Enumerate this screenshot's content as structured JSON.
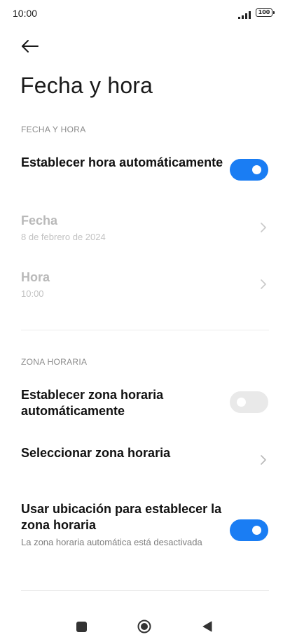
{
  "status_bar": {
    "time": "10:00",
    "battery": "100"
  },
  "header": {
    "title": "Fecha y hora"
  },
  "sections": {
    "date_time": {
      "header": "FECHA Y HORA",
      "auto_time": {
        "title": "Establecer hora automáticamente",
        "enabled": true
      },
      "date": {
        "title": "Fecha",
        "value": "8 de febrero de 2024"
      },
      "time": {
        "title": "Hora",
        "value": "10:00"
      }
    },
    "time_zone": {
      "header": "ZONA HORARIA",
      "auto_zone": {
        "title": "Establecer zona horaria automáticamente",
        "enabled": false
      },
      "select_zone": {
        "title": "Seleccionar zona horaria"
      },
      "location_zone": {
        "title": "Usar ubicación para establecer la zona horaria",
        "subtitle": "La zona horaria automática está desactivada",
        "enabled": true
      }
    }
  },
  "colors": {
    "accent": "#1a7df3",
    "toggle_off": "#e9e9e9",
    "disabled_text": "#b9b9b9"
  },
  "icons": {
    "back": "arrow-left-icon",
    "chevron": "chevron-right-icon",
    "nav_recents": "square-icon",
    "nav_home": "circle-icon",
    "nav_back": "triangle-left-icon"
  }
}
